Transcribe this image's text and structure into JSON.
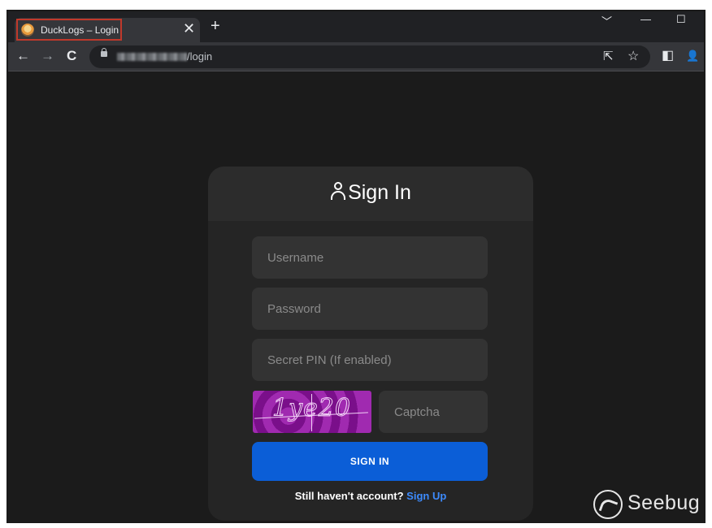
{
  "browser": {
    "tab_title": "DuckLogs – Login",
    "tab_close": "✕",
    "new_tab": "+",
    "url_path": "/login",
    "controls": {
      "chevron": "﹀",
      "minimize": "—",
      "maximize": "☐"
    },
    "nav": {
      "back": "←",
      "forward": "→",
      "reload": "C"
    },
    "toolbar_icons": {
      "share": "⇱",
      "star": "☆",
      "sidepanel": "◧",
      "profile": "👤"
    }
  },
  "login": {
    "title": "Sign In",
    "username_placeholder": "Username",
    "password_placeholder": "Password",
    "pin_placeholder": "Secret PIN (If enabled)",
    "captcha_image_text": "1ye20",
    "captcha_placeholder": "Captcha",
    "submit_label": "SIGN IN",
    "signup_prompt": "Still haven't account?",
    "signup_link": "Sign Up"
  },
  "watermark": {
    "text": "Seebug"
  },
  "colors": {
    "primary_button": "#0b5ed7",
    "link": "#3d8bfd",
    "card": "#252525",
    "input": "#333333"
  }
}
